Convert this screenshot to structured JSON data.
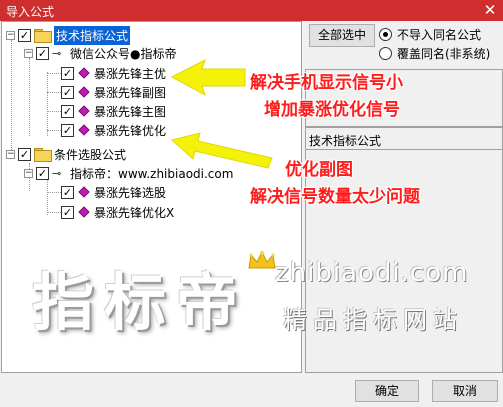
{
  "window": {
    "title": "导入公式",
    "close_glyph": "✕"
  },
  "tree": {
    "nodes": [
      {
        "label": "技术指标公式",
        "checked": true,
        "selected": true
      },
      {
        "label": "微信公众号●指标帝",
        "checked": true
      },
      {
        "label": "暴涨先锋主优",
        "checked": true
      },
      {
        "label": "暴涨先锋副图",
        "checked": true
      },
      {
        "label": "暴涨先锋主图",
        "checked": true
      },
      {
        "label": "暴涨先锋优化",
        "checked": true
      },
      {
        "label": "条件选股公式",
        "checked": true
      },
      {
        "label": "指标帝：www.zhibiaodi.com",
        "checked": true
      },
      {
        "label": "暴涨先锋选股",
        "checked": true
      },
      {
        "label": "暴涨先锋优化X",
        "checked": true
      }
    ],
    "expander_glyph": "−",
    "check_glyph": "✓",
    "key_glyph": "⊸"
  },
  "options": {
    "select_all_label": "全部选中",
    "radio_skip_label": "不导入同名公式",
    "radio_overwrite_label": "覆盖同名(非系统)",
    "selected_radio": "skip"
  },
  "description": {
    "title": "技术指标公式"
  },
  "buttons": {
    "ok_label": "确定",
    "cancel_label": "取消"
  },
  "annotations": {
    "line1": "解决手机显示信号小",
    "line2": "增加暴涨优化信号",
    "line3": "优化副图",
    "line4": "解决信号数量太少问题"
  },
  "watermark": {
    "brand": "指标帝",
    "url": "zhibiaodi.com",
    "slogan": "精品指标网站"
  },
  "colors": {
    "title_bar": "#cf2e2e",
    "selection": "#0a64d8",
    "annotation_text": "#ff1c1c",
    "arrow_fill": "#f5f20a",
    "formula_gem": "#c21bb3"
  }
}
